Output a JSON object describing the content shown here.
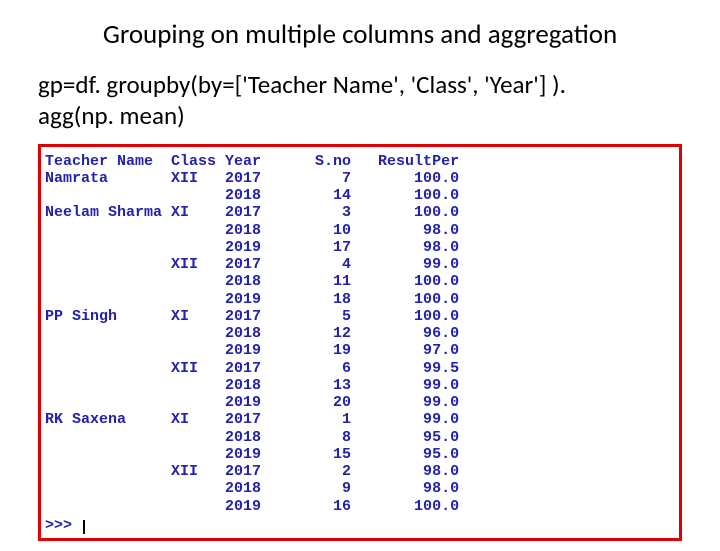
{
  "title": "Grouping on multiple columns and aggregation",
  "code_line1": "gp=df. groupby(by=['Teacher Name', 'Class', 'Year'] ).",
  "code_line2": "agg(np. mean)",
  "prompt": ">>> ",
  "chart_data": {
    "type": "table",
    "columns": [
      "Teacher Name",
      "Class",
      "Year",
      "S.no",
      "ResultPer"
    ],
    "rows": [
      {
        "teacher": "Namrata",
        "class": "XII",
        "year": 2017,
        "sno": 7,
        "result": 100.0
      },
      {
        "teacher": "",
        "class": "",
        "year": 2018,
        "sno": 14,
        "result": 100.0
      },
      {
        "teacher": "Neelam Sharma",
        "class": "XI",
        "year": 2017,
        "sno": 3,
        "result": 100.0
      },
      {
        "teacher": "",
        "class": "",
        "year": 2018,
        "sno": 10,
        "result": 98.0
      },
      {
        "teacher": "",
        "class": "",
        "year": 2019,
        "sno": 17,
        "result": 98.0
      },
      {
        "teacher": "",
        "class": "XII",
        "year": 2017,
        "sno": 4,
        "result": 99.0
      },
      {
        "teacher": "",
        "class": "",
        "year": 2018,
        "sno": 11,
        "result": 100.0
      },
      {
        "teacher": "",
        "class": "",
        "year": 2019,
        "sno": 18,
        "result": 100.0
      },
      {
        "teacher": "PP Singh",
        "class": "XI",
        "year": 2017,
        "sno": 5,
        "result": 100.0
      },
      {
        "teacher": "",
        "class": "",
        "year": 2018,
        "sno": 12,
        "result": 96.0
      },
      {
        "teacher": "",
        "class": "",
        "year": 2019,
        "sno": 19,
        "result": 97.0
      },
      {
        "teacher": "",
        "class": "XII",
        "year": 2017,
        "sno": 6,
        "result": 99.5
      },
      {
        "teacher": "",
        "class": "",
        "year": 2018,
        "sno": 13,
        "result": 99.0
      },
      {
        "teacher": "",
        "class": "",
        "year": 2019,
        "sno": 20,
        "result": 99.0
      },
      {
        "teacher": "RK Saxena",
        "class": "XI",
        "year": 2017,
        "sno": 1,
        "result": 99.0
      },
      {
        "teacher": "",
        "class": "",
        "year": 2018,
        "sno": 8,
        "result": 95.0
      },
      {
        "teacher": "",
        "class": "",
        "year": 2019,
        "sno": 15,
        "result": 95.0
      },
      {
        "teacher": "",
        "class": "XII",
        "year": 2017,
        "sno": 2,
        "result": 98.0
      },
      {
        "teacher": "",
        "class": "",
        "year": 2018,
        "sno": 9,
        "result": 98.0
      },
      {
        "teacher": "",
        "class": "",
        "year": 2019,
        "sno": 16,
        "result": 100.0
      }
    ]
  }
}
